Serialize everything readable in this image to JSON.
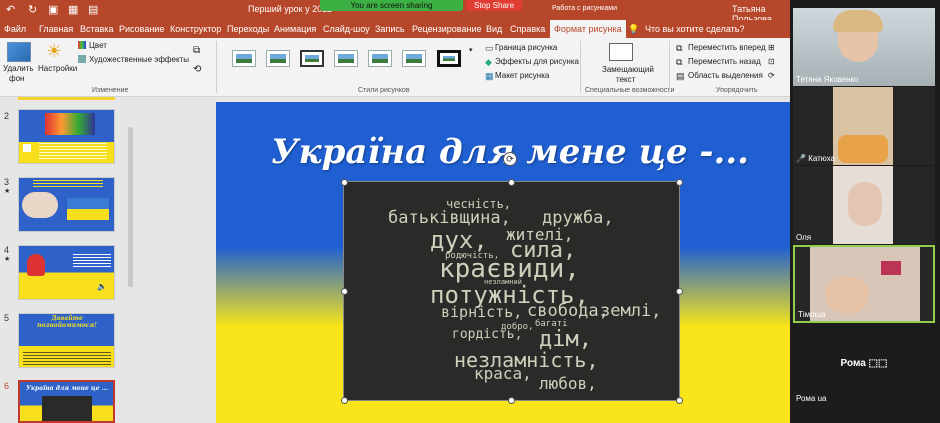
{
  "titlebar": {
    "doc_title": "Перший урок у 2022-",
    "share_banner": "You are screen sharing",
    "stop_share": "Stop Share",
    "context_tab": "Работа с рисунками",
    "user": "Татьяна Пользова"
  },
  "tabs": [
    "Файл",
    "Главная",
    "Вставка",
    "Рисование",
    "Конструктор",
    "Переходы",
    "Анимация",
    "Слайд-шоу",
    "Запись",
    "Рецензирование",
    "Вид",
    "Справка",
    "Формат рисунка"
  ],
  "tell_me": "Что вы хотите сделать?",
  "ribbon": {
    "remove_bg_line1": "Удалить",
    "remove_bg_line2": "фон",
    "corrections": "Настройки",
    "color": "Цвет",
    "artistic": "Художественные эффекты",
    "group_adjust": "Изменение",
    "group_styles": "Стили рисунков",
    "border": "Граница рисунка",
    "effects": "Эффекты для рисунка",
    "layout": "Макет рисунка",
    "alt_text_line1": "Замещающий",
    "alt_text_line2": "текст",
    "group_access": "Специальные возможности",
    "bring_forward": "Переместить вперед",
    "send_backward": "Переместить назад",
    "selection_pane": "Область выделения",
    "group_arrange": "Упорядочить"
  },
  "slides": [
    {
      "num": "2",
      "star": "",
      "title": ""
    },
    {
      "num": "3",
      "star": "★",
      "title": ""
    },
    {
      "num": "4",
      "star": "★",
      "title": ""
    },
    {
      "num": "5",
      "star": "",
      "title": "Давайте познайомимося!"
    },
    {
      "num": "6",
      "star": "",
      "title": "Україна для мене це ..."
    }
  ],
  "slide": {
    "title": "Україна для мене це -...",
    "words": [
      "чесність,",
      "батьківщина,",
      "дружба,",
      "дух,",
      "жителі,",
      "сила,",
      "родючість,",
      "краєвиди,",
      "незламний",
      "потужність,",
      "вірність,",
      "свобода,",
      "землі,",
      "добро,",
      "багаті",
      "гордість,",
      "дім,",
      "незламність,",
      "краса,",
      "любов,"
    ]
  },
  "participants": [
    "Тетяна Яковенко",
    "Катюха",
    "Оля",
    "Тімоша",
    "Рома ua"
  ],
  "participant_name_only": "Рома ⬚⬚",
  "colors": {
    "accent": "#b7472a",
    "share_green": "#3cb043",
    "stop_red": "#e03c31",
    "slide_blue": "#1f5fd1",
    "slide_yellow": "#f9e51a"
  }
}
